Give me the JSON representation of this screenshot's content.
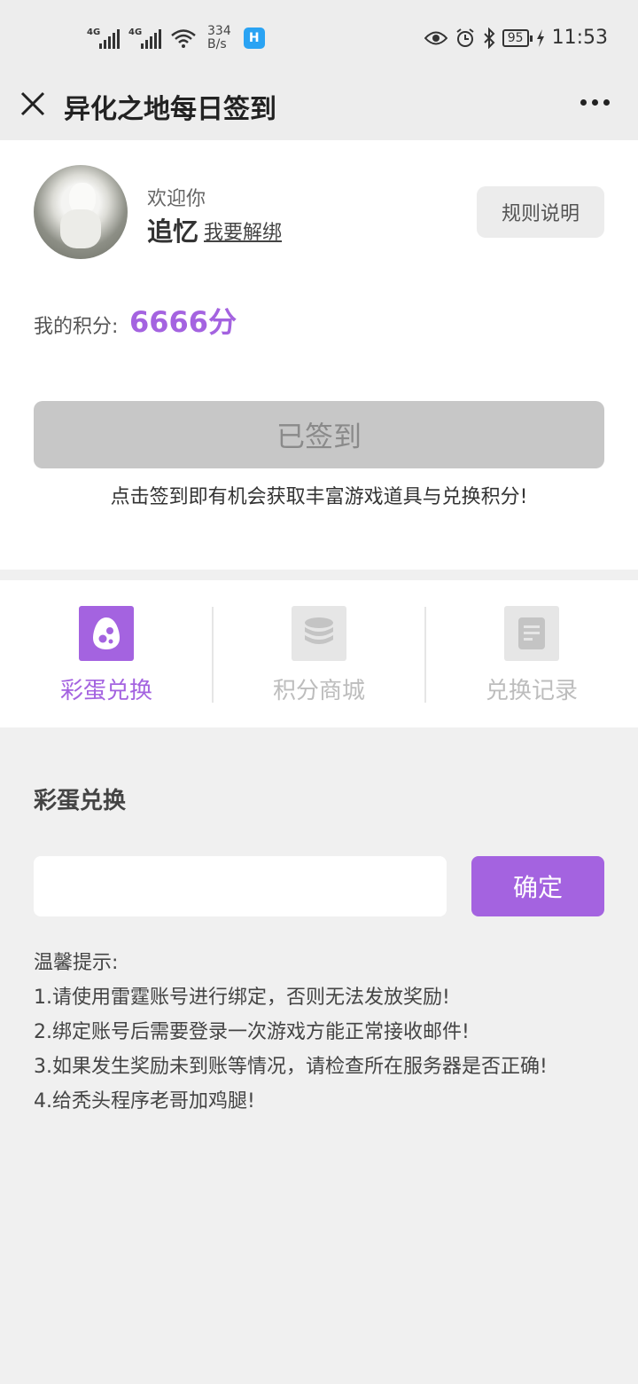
{
  "status_bar": {
    "signal_label_1": "4G",
    "signal_label_2": "4G",
    "net_speed_value": "334",
    "net_speed_unit": "B/s",
    "app_badge_glyph": "H",
    "battery": "95",
    "time": "11:53"
  },
  "nav": {
    "title": "异化之地每日签到"
  },
  "profile": {
    "welcome": "欢迎你",
    "username": "追忆",
    "unbind_link": "我要解绑",
    "rules_button": "规则说明"
  },
  "points": {
    "label": "我的积分:",
    "value": "6666分"
  },
  "signin": {
    "button_label": "已签到",
    "hint": "点击签到即有机会获取丰富游戏道具与兑换积分!"
  },
  "tabs": [
    {
      "label": "彩蛋兑换",
      "icon": "egg-icon",
      "active": true
    },
    {
      "label": "积分商城",
      "icon": "coin-stack-icon",
      "active": false
    },
    {
      "label": "兑换记录",
      "icon": "document-icon",
      "active": false
    }
  ],
  "exchange": {
    "title": "彩蛋兑换",
    "input_value": "",
    "input_placeholder": "",
    "confirm_label": "确定",
    "tips_title": "温馨提示:",
    "tips": [
      "1.请使用雷霆账号进行绑定，否则无法发放奖励!",
      "2.绑定账号后需要登录一次游戏方能正常接收邮件!",
      "3.如果发生奖励未到账等情况，请检查所在服务器是否正确!",
      "4.给秃头程序老哥加鸡腿!"
    ]
  },
  "colors": {
    "accent": "#a463e0",
    "disabled_button": "#c7c7c7",
    "page_background": "#f0f0f0"
  }
}
